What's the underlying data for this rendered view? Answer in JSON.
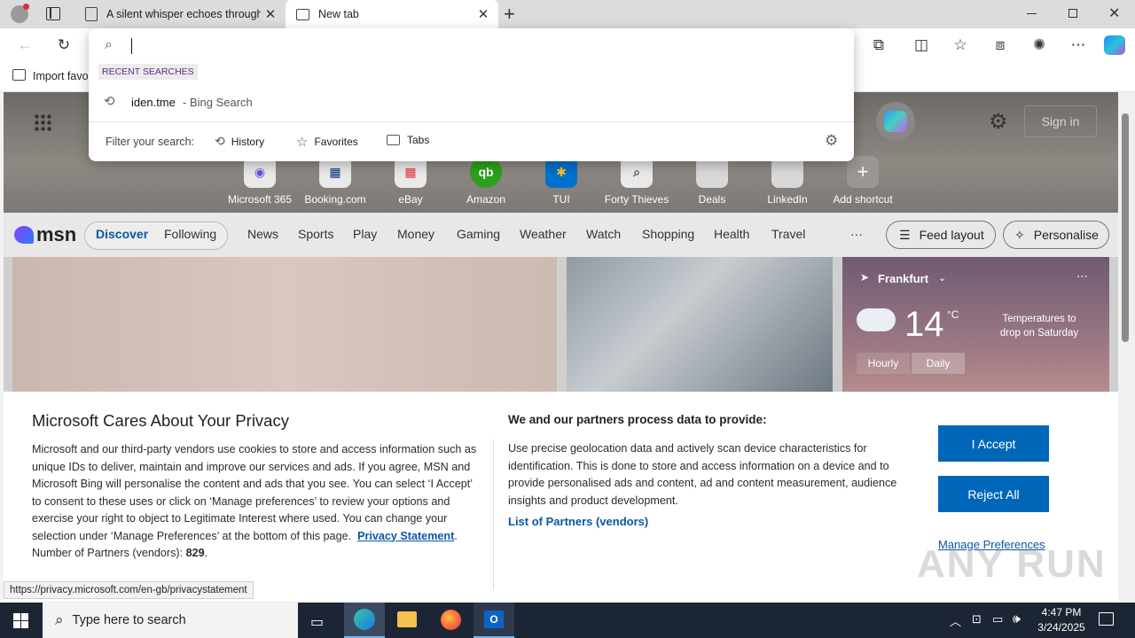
{
  "browser": {
    "tabs": [
      {
        "title": "A silent whisper echoes through"
      },
      {
        "title": "New tab"
      }
    ],
    "favorites_bar": {
      "import_label": "Import favo"
    }
  },
  "omnibox": {
    "recent_header": "RECENT SEARCHES",
    "recent_items": [
      {
        "query": "iden.tme",
        "source": "- Bing Search"
      }
    ],
    "filter_label": "Filter your search:",
    "filters": [
      "History",
      "Favorites",
      "Tabs"
    ]
  },
  "newtab": {
    "sign_in": "Sign in",
    "shortcuts": [
      {
        "label": "Microsoft 365"
      },
      {
        "label": "Booking.com"
      },
      {
        "label": "eBay"
      },
      {
        "label": "Amazon"
      },
      {
        "label": "TUI"
      },
      {
        "label": "Forty Thieves"
      },
      {
        "label": "Deals"
      },
      {
        "label": "LinkedIn"
      },
      {
        "label": "Add shortcut"
      }
    ],
    "msn": {
      "logo": "msn",
      "tabs": [
        "Discover",
        "Following"
      ],
      "nav": [
        "News",
        "Sports",
        "Play",
        "Money",
        "Gaming",
        "Weather",
        "Watch",
        "Shopping",
        "Health",
        "Travel"
      ],
      "more": "···",
      "feed_layout": "Feed layout",
      "personalise": "Personalise"
    },
    "weather": {
      "location": "Frankfurt",
      "temp": "14",
      "unit": "°C",
      "note": "Temperatures to drop on Saturday",
      "tabs": [
        "Hourly",
        "Daily"
      ]
    }
  },
  "privacy": {
    "title": "Microsoft Cares About Your Privacy",
    "body": "Microsoft and our third-party vendors use cookies to store and access information such as unique IDs to deliver, maintain and improve our services and ads. If you agree, MSN and Microsoft Bing will personalise the content and ads that you see. You can select ‘I Accept’ to consent to these uses or click on ‘Manage preferences’ to review your options and exercise your right to object to Legitimate Interest where used.  You can change your selection under ‘Manage Preferences’ at the bottom of this page.",
    "privacy_link": "Privacy Statement",
    "partners_label": "Number of Partners (vendors):",
    "partners_count": "829",
    "right_title": "We and our partners process data to provide:",
    "right_body": "Use precise geolocation data and actively scan device characteristics for identification. This is done to store and access information on a device and to provide personalised ads and content, ad and content measurement, audience insights and product development.",
    "partners_link": "List of Partners (vendors)",
    "accept": "I Accept",
    "reject": "Reject All",
    "manage": "Manage Preferences"
  },
  "status_url": "https://privacy.microsoft.com/en-gb/privacystatement",
  "taskbar": {
    "search_placeholder": "Type here to search",
    "time": "4:47 PM",
    "date": "3/24/2025"
  },
  "watermark": "ANY RUN"
}
